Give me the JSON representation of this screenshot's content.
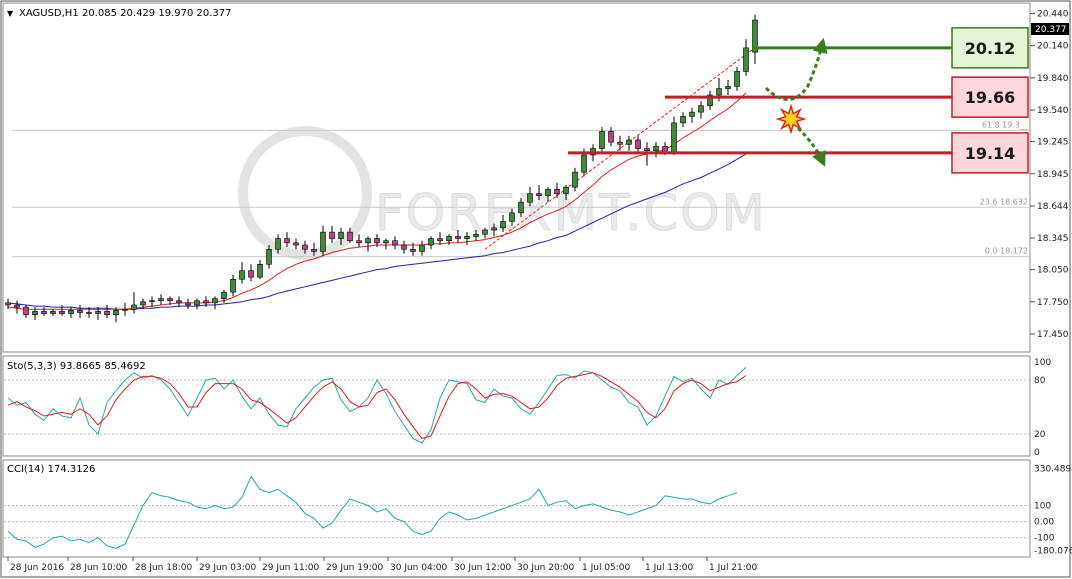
{
  "symbol_label": "XAGUSD,H1",
  "ohlc_text": "20.085 20.429 19.970 20.377",
  "last_price_tag": "20.377",
  "watermark_text": "FOREXMT.COM",
  "colors": {
    "bull": "#3d8a3d",
    "bear": "#c03f84",
    "ma_fast": "#e02020",
    "ma_slow": "#2020b0",
    "stoch_main": "#2aa7a7",
    "stoch_signal": "#e02020",
    "cci": "#2aa7a7",
    "level_up": "#3a7d1f",
    "level_down": "#bf1e2e",
    "trend": "#e02020"
  },
  "chart_data": [
    {
      "type": "candlestick",
      "name": "price",
      "ylim": [
        17.3,
        20.52
      ],
      "y_ticks": [
        "20.440",
        "20.140",
        "19.840",
        "19.540",
        "19.245",
        "18.945",
        "18.644",
        "18.345",
        "18.050",
        "17.750",
        "17.450"
      ],
      "x_ticks": [
        "28 Jun 2016",
        "28 Jun 10:00",
        "28 Jun 18:00",
        "29 Jun 03:00",
        "29 Jun 11:00",
        "29 Jun 19:00",
        "30 Jun 04:00",
        "30 Jun 12:00",
        "30 Jun 20:00",
        "1 Jul 05:00",
        "1 Jul 13:00",
        "1 Jul 21:00"
      ],
      "candles_ohlc": [
        [
          17.74,
          17.78,
          17.68,
          17.72
        ],
        [
          17.72,
          17.76,
          17.64,
          17.7
        ],
        [
          17.7,
          17.72,
          17.6,
          17.63
        ],
        [
          17.63,
          17.7,
          17.58,
          17.66
        ],
        [
          17.66,
          17.7,
          17.62,
          17.64
        ],
        [
          17.64,
          17.68,
          17.62,
          17.66
        ],
        [
          17.66,
          17.72,
          17.62,
          17.64
        ],
        [
          17.64,
          17.7,
          17.6,
          17.67
        ],
        [
          17.67,
          17.72,
          17.6,
          17.65
        ],
        [
          17.65,
          17.7,
          17.6,
          17.64
        ],
        [
          17.64,
          17.7,
          17.58,
          17.66
        ],
        [
          17.66,
          17.72,
          17.6,
          17.63
        ],
        [
          17.63,
          17.7,
          17.56,
          17.67
        ],
        [
          17.67,
          17.74,
          17.62,
          17.68
        ],
        [
          17.68,
          17.84,
          17.64,
          17.72
        ],
        [
          17.72,
          17.78,
          17.68,
          17.75
        ],
        [
          17.75,
          17.8,
          17.7,
          17.76
        ],
        [
          17.76,
          17.82,
          17.72,
          17.78
        ],
        [
          17.78,
          17.8,
          17.72,
          17.76
        ],
        [
          17.76,
          17.8,
          17.7,
          17.74
        ],
        [
          17.74,
          17.78,
          17.68,
          17.72
        ],
        [
          17.72,
          17.78,
          17.68,
          17.76
        ],
        [
          17.76,
          17.8,
          17.7,
          17.74
        ],
        [
          17.74,
          17.8,
          17.68,
          17.78
        ],
        [
          17.78,
          17.86,
          17.74,
          17.84
        ],
        [
          17.84,
          18.0,
          17.8,
          17.96
        ],
        [
          17.96,
          18.12,
          17.92,
          18.04
        ],
        [
          18.04,
          18.1,
          17.94,
          17.98
        ],
        [
          17.98,
          18.14,
          17.96,
          18.1
        ],
        [
          18.1,
          18.28,
          18.06,
          18.24
        ],
        [
          18.24,
          18.38,
          18.2,
          18.34
        ],
        [
          18.34,
          18.4,
          18.26,
          18.3
        ],
        [
          18.3,
          18.34,
          18.24,
          18.28
        ],
        [
          18.28,
          18.32,
          18.2,
          18.24
        ],
        [
          18.24,
          18.3,
          18.18,
          18.22
        ],
        [
          18.22,
          18.46,
          18.18,
          18.4
        ],
        [
          18.4,
          18.46,
          18.3,
          18.34
        ],
        [
          18.34,
          18.44,
          18.28,
          18.4
        ],
        [
          18.4,
          18.44,
          18.3,
          18.32
        ],
        [
          18.32,
          18.38,
          18.26,
          18.3
        ],
        [
          18.3,
          18.36,
          18.22,
          18.34
        ],
        [
          18.34,
          18.38,
          18.26,
          18.3
        ],
        [
          18.3,
          18.34,
          18.24,
          18.32
        ],
        [
          18.32,
          18.36,
          18.24,
          18.28
        ],
        [
          18.28,
          18.32,
          18.2,
          18.24
        ],
        [
          18.24,
          18.3,
          18.18,
          18.22
        ],
        [
          18.22,
          18.32,
          18.18,
          18.28
        ],
        [
          18.28,
          18.36,
          18.24,
          18.34
        ],
        [
          18.34,
          18.4,
          18.28,
          18.32
        ],
        [
          18.32,
          18.38,
          18.28,
          18.36
        ],
        [
          18.36,
          18.42,
          18.3,
          18.34
        ],
        [
          18.34,
          18.4,
          18.28,
          18.36
        ],
        [
          18.36,
          18.42,
          18.32,
          18.38
        ],
        [
          18.38,
          18.44,
          18.34,
          18.42
        ],
        [
          18.42,
          18.48,
          18.36,
          18.44
        ],
        [
          18.44,
          18.56,
          18.4,
          18.5
        ],
        [
          18.5,
          18.62,
          18.46,
          18.58
        ],
        [
          18.58,
          18.72,
          18.54,
          18.68
        ],
        [
          18.68,
          18.82,
          18.64,
          18.76
        ],
        [
          18.76,
          18.84,
          18.7,
          18.74
        ],
        [
          18.74,
          18.82,
          18.68,
          18.8
        ],
        [
          18.8,
          18.86,
          18.72,
          18.76
        ],
        [
          18.76,
          18.84,
          18.7,
          18.82
        ],
        [
          18.82,
          19.0,
          18.78,
          18.96
        ],
        [
          18.96,
          19.18,
          18.92,
          19.12
        ],
        [
          19.12,
          19.22,
          19.06,
          19.18
        ],
        [
          19.18,
          19.38,
          19.14,
          19.34
        ],
        [
          19.34,
          19.38,
          19.2,
          19.24
        ],
        [
          19.24,
          19.3,
          19.16,
          19.22
        ],
        [
          19.22,
          19.3,
          19.16,
          19.26
        ],
        [
          19.26,
          19.3,
          19.14,
          19.18
        ],
        [
          19.18,
          19.24,
          19.02,
          19.16
        ],
        [
          19.16,
          19.24,
          19.1,
          19.2
        ],
        [
          19.2,
          19.24,
          19.12,
          19.14
        ],
        [
          19.14,
          19.48,
          19.12,
          19.42
        ],
        [
          19.42,
          19.52,
          19.38,
          19.48
        ],
        [
          19.48,
          19.56,
          19.42,
          19.52
        ],
        [
          19.52,
          19.62,
          19.46,
          19.58
        ],
        [
          19.58,
          19.72,
          19.54,
          19.68
        ],
        [
          19.68,
          19.84,
          19.62,
          19.74
        ],
        [
          19.74,
          19.82,
          19.68,
          19.76
        ],
        [
          19.76,
          19.94,
          19.72,
          19.9
        ],
        [
          19.9,
          20.2,
          19.86,
          20.12
        ],
        [
          20.08,
          20.43,
          19.97,
          20.38
        ]
      ],
      "ma_fast_values": [
        17.7,
        17.69,
        17.68,
        17.68,
        17.68,
        17.68,
        17.68,
        17.68,
        17.68,
        17.68,
        17.68,
        17.68,
        17.68,
        17.68,
        17.69,
        17.7,
        17.71,
        17.72,
        17.73,
        17.74,
        17.74,
        17.74,
        17.74,
        17.75,
        17.76,
        17.79,
        17.83,
        17.86,
        17.9,
        17.95,
        18.01,
        18.06,
        18.1,
        18.13,
        18.15,
        18.18,
        18.21,
        18.23,
        18.25,
        18.26,
        18.27,
        18.28,
        18.28,
        18.28,
        18.28,
        18.28,
        18.28,
        18.29,
        18.29,
        18.3,
        18.3,
        18.31,
        18.32,
        18.33,
        18.35,
        18.37,
        18.4,
        18.44,
        18.49,
        18.53,
        18.57,
        18.6,
        18.64,
        18.7,
        18.77,
        18.84,
        18.92,
        18.98,
        19.03,
        19.08,
        19.11,
        19.13,
        19.15,
        19.17,
        19.22,
        19.28,
        19.33,
        19.38,
        19.44,
        19.5,
        19.55,
        19.62,
        19.7
      ],
      "ma_slow_values": [
        17.74,
        17.73,
        17.72,
        17.71,
        17.71,
        17.7,
        17.7,
        17.7,
        17.69,
        17.69,
        17.69,
        17.69,
        17.68,
        17.68,
        17.68,
        17.69,
        17.69,
        17.7,
        17.7,
        17.71,
        17.71,
        17.71,
        17.72,
        17.72,
        17.73,
        17.74,
        17.75,
        17.77,
        17.78,
        17.8,
        17.83,
        17.85,
        17.87,
        17.89,
        17.91,
        17.93,
        17.95,
        17.97,
        17.99,
        18.01,
        18.03,
        18.05,
        18.06,
        18.08,
        18.09,
        18.1,
        18.11,
        18.12,
        18.13,
        18.14,
        18.15,
        18.16,
        18.17,
        18.18,
        18.2,
        18.21,
        18.23,
        18.25,
        18.27,
        18.3,
        18.32,
        18.35,
        18.37,
        18.41,
        18.45,
        18.49,
        18.53,
        18.57,
        18.61,
        18.65,
        18.68,
        18.71,
        18.74,
        18.77,
        18.81,
        18.85,
        18.88,
        18.91,
        18.95,
        18.99,
        19.03,
        19.08,
        19.13
      ],
      "trend_line_from_to": [
        [
          18.24,
          53
        ],
        [
          20.12,
          83
        ]
      ],
      "levels": [
        {
          "label": "20.12",
          "value": 20.12,
          "kind": "resistance-target"
        },
        {
          "label": "19.66",
          "value": 19.66,
          "kind": "pivot"
        },
        {
          "label": "19.14",
          "value": 19.14,
          "kind": "support-target"
        }
      ],
      "fibo": [
        {
          "label": "61.8 19.3__",
          "value": 19.35
        },
        {
          "label": "23.6 18.632",
          "value": 18.632
        },
        {
          "label": "0.0 18.172",
          "value": 18.172
        }
      ]
    },
    {
      "type": "line",
      "name": "Stochastic",
      "label": "Sto(5,3,3) 93.8665 85.4692",
      "ylim": [
        0,
        100
      ],
      "y_ticks": [
        "100",
        "80",
        "20",
        "0"
      ],
      "levels": [
        80,
        20
      ],
      "main_values": [
        60,
        52,
        55,
        42,
        35,
        48,
        40,
        38,
        60,
        30,
        20,
        55,
        68,
        80,
        88,
        82,
        85,
        80,
        70,
        55,
        40,
        60,
        80,
        82,
        70,
        80,
        62,
        48,
        60,
        42,
        30,
        28,
        48,
        60,
        72,
        80,
        82,
        58,
        45,
        50,
        60,
        80,
        65,
        45,
        30,
        15,
        10,
        25,
        60,
        80,
        78,
        76,
        58,
        55,
        70,
        62,
        60,
        48,
        42,
        55,
        70,
        85,
        86,
        82,
        90,
        88,
        80,
        72,
        68,
        55,
        50,
        30,
        40,
        62,
        84,
        78,
        82,
        70,
        60,
        80,
        75,
        85,
        94
      ],
      "signal_values": [
        52,
        56,
        50,
        46,
        40,
        42,
        44,
        42,
        48,
        42,
        30,
        40,
        58,
        70,
        80,
        84,
        84,
        82,
        76,
        65,
        50,
        50,
        66,
        76,
        76,
        76,
        70,
        58,
        55,
        48,
        40,
        32,
        38,
        50,
        62,
        72,
        78,
        70,
        56,
        50,
        52,
        66,
        70,
        58,
        42,
        28,
        15,
        18,
        40,
        62,
        76,
        78,
        70,
        60,
        64,
        65,
        62,
        55,
        48,
        50,
        60,
        74,
        82,
        84,
        86,
        88,
        84,
        78,
        72,
        64,
        56,
        44,
        38,
        48,
        68,
        76,
        80,
        76,
        68,
        72,
        76,
        78,
        85
      ]
    },
    {
      "type": "line",
      "name": "CCI",
      "label": "CCI(14) 174.3126",
      "ylim": [
        -195,
        345
      ],
      "y_ticks": [
        "330.4894",
        "100",
        "0.00",
        "-100",
        "-180.076"
      ],
      "levels": [
        100,
        0,
        -100
      ],
      "values": [
        -60,
        -110,
        -120,
        -160,
        -140,
        -100,
        -90,
        -120,
        -110,
        -130,
        -100,
        -150,
        -165,
        -140,
        -20,
        100,
        180,
        160,
        150,
        130,
        120,
        90,
        80,
        100,
        80,
        90,
        150,
        280,
        200,
        180,
        200,
        160,
        120,
        50,
        20,
        -40,
        -10,
        70,
        140,
        120,
        100,
        60,
        80,
        20,
        0,
        -60,
        -80,
        -60,
        20,
        60,
        40,
        10,
        20,
        40,
        60,
        80,
        100,
        120,
        140,
        200,
        100,
        120,
        130,
        80,
        100,
        110,
        90,
        70,
        60,
        40,
        60,
        80,
        100,
        160,
        150,
        140,
        140,
        120,
        110,
        140,
        160,
        180
      ]
    }
  ]
}
